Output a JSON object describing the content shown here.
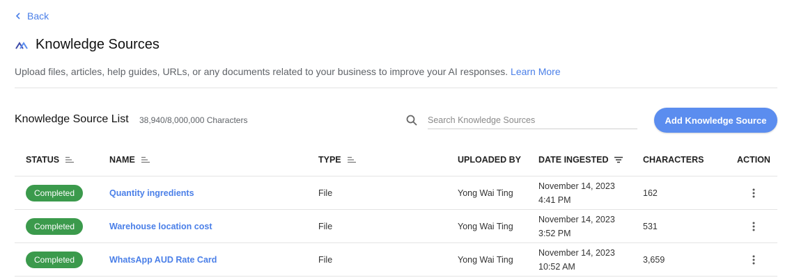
{
  "nav": {
    "back_label": "Back"
  },
  "page": {
    "title": "Knowledge Sources",
    "description": "Upload files, articles, help guides, URLs, or any documents related to your business to improve your AI responses.",
    "learn_more": "Learn More"
  },
  "list": {
    "title": "Knowledge Source List",
    "char_count": "38,940/8,000,000 Characters",
    "search_placeholder": "Search Knowledge Sources",
    "add_button": "Add Knowledge Source"
  },
  "table": {
    "headers": {
      "status": "STATUS",
      "name": "NAME",
      "type": "TYPE",
      "uploaded_by": "UPLOADED BY",
      "date_ingested": "DATE INGESTED",
      "characters": "CHARACTERS",
      "action": "ACTION"
    },
    "rows": [
      {
        "status": "Completed",
        "name": "Quantity ingredients",
        "type": "File",
        "uploaded_by": "Yong Wai Ting",
        "date": "November 14, 2023",
        "time": "4:41 PM",
        "characters": "162"
      },
      {
        "status": "Completed",
        "name": "Warehouse location cost",
        "type": "File",
        "uploaded_by": "Yong Wai Ting",
        "date": "November 14, 2023",
        "time": "3:52 PM",
        "characters": "531"
      },
      {
        "status": "Completed",
        "name": "WhatsApp AUD Rate Card",
        "type": "File",
        "uploaded_by": "Yong Wai Ting",
        "date": "November 14, 2023",
        "time": "10:52 AM",
        "characters": "3,659"
      }
    ]
  },
  "colors": {
    "accent": "#5b8def",
    "link": "#4a7fe8",
    "status_completed": "#3b9a4c"
  },
  "icons": {
    "back": "chevron-left-icon",
    "brand": "logo-icon",
    "search": "search-icon",
    "sort": "sort-icon",
    "more": "more-vertical-icon"
  }
}
